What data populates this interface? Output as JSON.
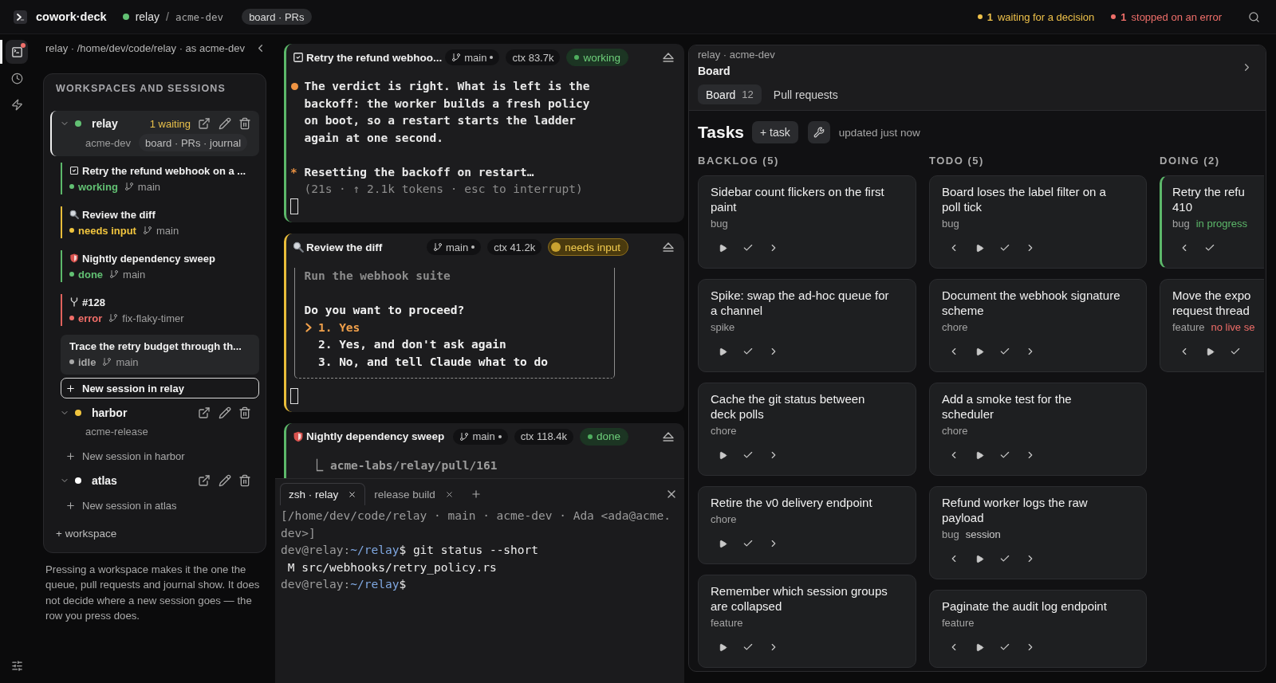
{
  "topbar": {
    "brand": "cowork·deck",
    "workspace": "relay",
    "separator": "/",
    "account": "acme-dev",
    "view": "board · PRs",
    "alerts": [
      {
        "count": "1",
        "text": "waiting for a decision",
        "color": "#eec14a"
      },
      {
        "count": "1",
        "text": "stopped on an error",
        "color": "#ef6f6a"
      }
    ]
  },
  "rail": [
    {
      "kind": "terminal",
      "selected": true,
      "alert": true
    },
    {
      "kind": "history",
      "selected": false,
      "alert": false
    },
    {
      "kind": "bolt",
      "selected": false,
      "alert": false
    }
  ],
  "sidebar": {
    "breadcrumb": "relay · /home/dev/code/relay · as acme-dev",
    "title": "WORKSPACES AND SESSIONS",
    "workspaces": [
      {
        "name": "relay",
        "color": "#62c073",
        "selected": true,
        "expanded": true,
        "waiting": "1 waiting",
        "account": "acme-dev",
        "scope": "board · PRs · journal",
        "sessions": [
          {
            "kind": "task",
            "title": "Retry the refund webhook on a ...",
            "status": {
              "kind": "working",
              "label": "working"
            },
            "branch": "main",
            "selected": false
          },
          {
            "kind": "search",
            "title": "Review the diff",
            "status": {
              "kind": "needs_input",
              "label": "needs input"
            },
            "branch": "main",
            "selected": false
          },
          {
            "kind": "shield",
            "title": "Nightly dependency sweep",
            "status": {
              "kind": "done",
              "label": "done"
            },
            "branch": "main",
            "selected": false
          },
          {
            "kind": "fork",
            "title": "#128",
            "status": {
              "kind": "error",
              "label": "error"
            },
            "branch": "fix-flaky-timer",
            "selected": false
          },
          {
            "title": "Trace the retry budget through th...",
            "status": {
              "kind": "idle",
              "label": "idle"
            },
            "branch": "main",
            "selected": true
          }
        ],
        "new_session": {
          "label": "New session in relay",
          "focused": true
        }
      },
      {
        "name": "harbor",
        "color": "#f0c43e",
        "selected": false,
        "expanded": true,
        "account": "acme-release",
        "new_session": {
          "label": "New session in harbor",
          "focused": false
        }
      },
      {
        "name": "atlas",
        "color": "#ffffff",
        "selected": false,
        "expanded": true,
        "new_session": {
          "label": "New session in atlas",
          "focused": false
        }
      }
    ],
    "add_workspace": "+ workspace",
    "note": "Pressing a workspace makes it the one the queue, pull requests and journal show. It does not decide where a new session goes — the row you press does."
  },
  "panes": [
    {
      "kind": "task",
      "title": "Retry the refund webhoo...",
      "branch": "main",
      "dirty": true,
      "context": "ctx 83.7k",
      "status": {
        "kind": "working",
        "label": "working"
      },
      "lines": [
        {
          "kind": "message",
          "text": "The verdict is right. What is left is the backoff: the worker builds a fresh policy on boot, so a restart starts the ladder again at one second."
        },
        {
          "kind": "blank"
        },
        {
          "kind": "spinner",
          "mark": "*",
          "text": "Resetting the backoff on restart…"
        },
        {
          "kind": "meta",
          "text": "(21s · ↑ 2.1k tokens · esc to interrupt)"
        },
        {
          "kind": "cursor"
        }
      ]
    },
    {
      "kind": "search",
      "title": "Review the diff",
      "branch": "main",
      "dirty": true,
      "context": "ctx 41.2k",
      "status": {
        "kind": "needs_input",
        "label": "needs input"
      },
      "lines": [
        {
          "kind": "prompt",
          "task": "Run the webhook suite",
          "question": "Do you want to proceed?",
          "options": [
            {
              "label": "1. Yes",
              "selected": true
            },
            {
              "label": "2. Yes, and don't ask again",
              "selected": false
            },
            {
              "label": "3. No, and tell Claude what to do",
              "selected": false
            }
          ]
        },
        {
          "kind": "cursor"
        }
      ]
    },
    {
      "kind": "shield",
      "title": "Nightly dependency sweep",
      "branch": "main",
      "dirty": true,
      "context": "ctx 118.4k",
      "status": {
        "kind": "done",
        "label": "done"
      },
      "lines": [
        {
          "kind": "result",
          "text": "⎿ acme-labs/relay/pull/161"
        }
      ]
    }
  ],
  "terminal": {
    "tabs": [
      {
        "label": "zsh · relay",
        "selected": true
      },
      {
        "label": "release build",
        "selected": false
      }
    ],
    "lines": [
      {
        "kind": "info",
        "text": "[/home/dev/code/relay · main · acme-dev · Ada <ada@acme.dev>]"
      },
      {
        "kind": "prompt",
        "host": "dev@relay:",
        "path": "~/relay",
        "symbol": "$",
        "command": "git status --short"
      },
      {
        "kind": "output",
        "text": "M src/webhooks/retry_policy.rs"
      },
      {
        "kind": "prompt",
        "host": "dev@relay:",
        "path": "~/relay",
        "symbol": "$"
      }
    ]
  },
  "board": {
    "breadcrumb": "relay · acme-dev",
    "title": "Board",
    "tabs": [
      {
        "label": "Board",
        "count": "12",
        "selected": true
      },
      {
        "label": "Pull requests",
        "selected": false
      }
    ],
    "heading": "Tasks",
    "add": "+ task",
    "updated": "updated just now",
    "columns": [
      {
        "title": "BACKLOG (5)",
        "cards": [
          {
            "title": "Sidebar count flickers on the first\npaint",
            "active": false,
            "tags": [
              {
                "kind": "type",
                "text": "bug"
              }
            ],
            "actions": [
              {
                "kind": "start"
              },
              {
                "kind": "done"
              },
              {
                "kind": "forward"
              }
            ]
          },
          {
            "title": "Spike: swap the ad-hoc queue for\na channel",
            "active": false,
            "tags": [
              {
                "kind": "type",
                "text": "spike"
              }
            ],
            "actions": [
              {
                "kind": "start"
              },
              {
                "kind": "done"
              },
              {
                "kind": "forward"
              }
            ]
          },
          {
            "title": "Cache the git status between\ndeck polls",
            "active": false,
            "tags": [
              {
                "kind": "type",
                "text": "chore"
              }
            ],
            "actions": [
              {
                "kind": "start"
              },
              {
                "kind": "done"
              },
              {
                "kind": "forward"
              }
            ]
          },
          {
            "title": "Retire the v0 delivery endpoint",
            "active": false,
            "tags": [
              {
                "kind": "type",
                "text": "chore"
              }
            ],
            "actions": [
              {
                "kind": "start"
              },
              {
                "kind": "done"
              },
              {
                "kind": "forward"
              }
            ]
          },
          {
            "title": "Remember which session groups\nare collapsed",
            "active": false,
            "tags": [
              {
                "kind": "type",
                "text": "feature"
              }
            ],
            "actions": [
              {
                "kind": "start"
              },
              {
                "kind": "done"
              },
              {
                "kind": "forward"
              }
            ]
          }
        ]
      },
      {
        "title": "TODO (5)",
        "cards": [
          {
            "title": "Board loses the label filter on a\npoll tick",
            "active": false,
            "tags": [
              {
                "kind": "type",
                "text": "bug"
              }
            ],
            "actions": [
              {
                "kind": "back"
              },
              {
                "kind": "start"
              },
              {
                "kind": "done"
              },
              {
                "kind": "forward"
              }
            ]
          },
          {
            "title": "Document the webhook signature\nscheme",
            "active": false,
            "tags": [
              {
                "kind": "type",
                "text": "chore"
              }
            ],
            "actions": [
              {
                "kind": "back"
              },
              {
                "kind": "start"
              },
              {
                "kind": "done"
              },
              {
                "kind": "forward"
              }
            ]
          },
          {
            "title": "Add a smoke test for the\nscheduler",
            "active": false,
            "tags": [
              {
                "kind": "type",
                "text": "chore"
              }
            ],
            "actions": [
              {
                "kind": "back"
              },
              {
                "kind": "start"
              },
              {
                "kind": "done"
              },
              {
                "kind": "forward"
              }
            ]
          },
          {
            "title": "Refund worker logs the raw\npayload",
            "active": false,
            "tags": [
              {
                "kind": "type",
                "text": "bug"
              },
              {
                "kind": "ref",
                "text": "session"
              }
            ],
            "actions": [
              {
                "kind": "back"
              },
              {
                "kind": "start"
              },
              {
                "kind": "done"
              },
              {
                "kind": "forward"
              }
            ]
          },
          {
            "title": "Paginate the audit log endpoint",
            "active": false,
            "tags": [
              {
                "kind": "type",
                "text": "feature"
              }
            ],
            "actions": [
              {
                "kind": "back"
              },
              {
                "kind": "start"
              },
              {
                "kind": "done"
              },
              {
                "kind": "forward"
              }
            ]
          }
        ]
      },
      {
        "title": "DOING (2)",
        "cards": [
          {
            "title": "Retry the refu\n410",
            "active": true,
            "tags": [
              {
                "kind": "type",
                "text": "bug"
              },
              {
                "kind": "progress",
                "text": "in progress"
              }
            ],
            "actions": [
              {
                "kind": "back"
              },
              {
                "kind": "done"
              }
            ]
          },
          {
            "title": "Move the expo\nrequest thread",
            "active": false,
            "tags": [
              {
                "kind": "type",
                "text": "feature"
              },
              {
                "kind": "alert",
                "text": "no live se"
              }
            ],
            "actions": [
              {
                "kind": "back"
              },
              {
                "kind": "start"
              },
              {
                "kind": "done"
              }
            ]
          }
        ]
      }
    ]
  }
}
